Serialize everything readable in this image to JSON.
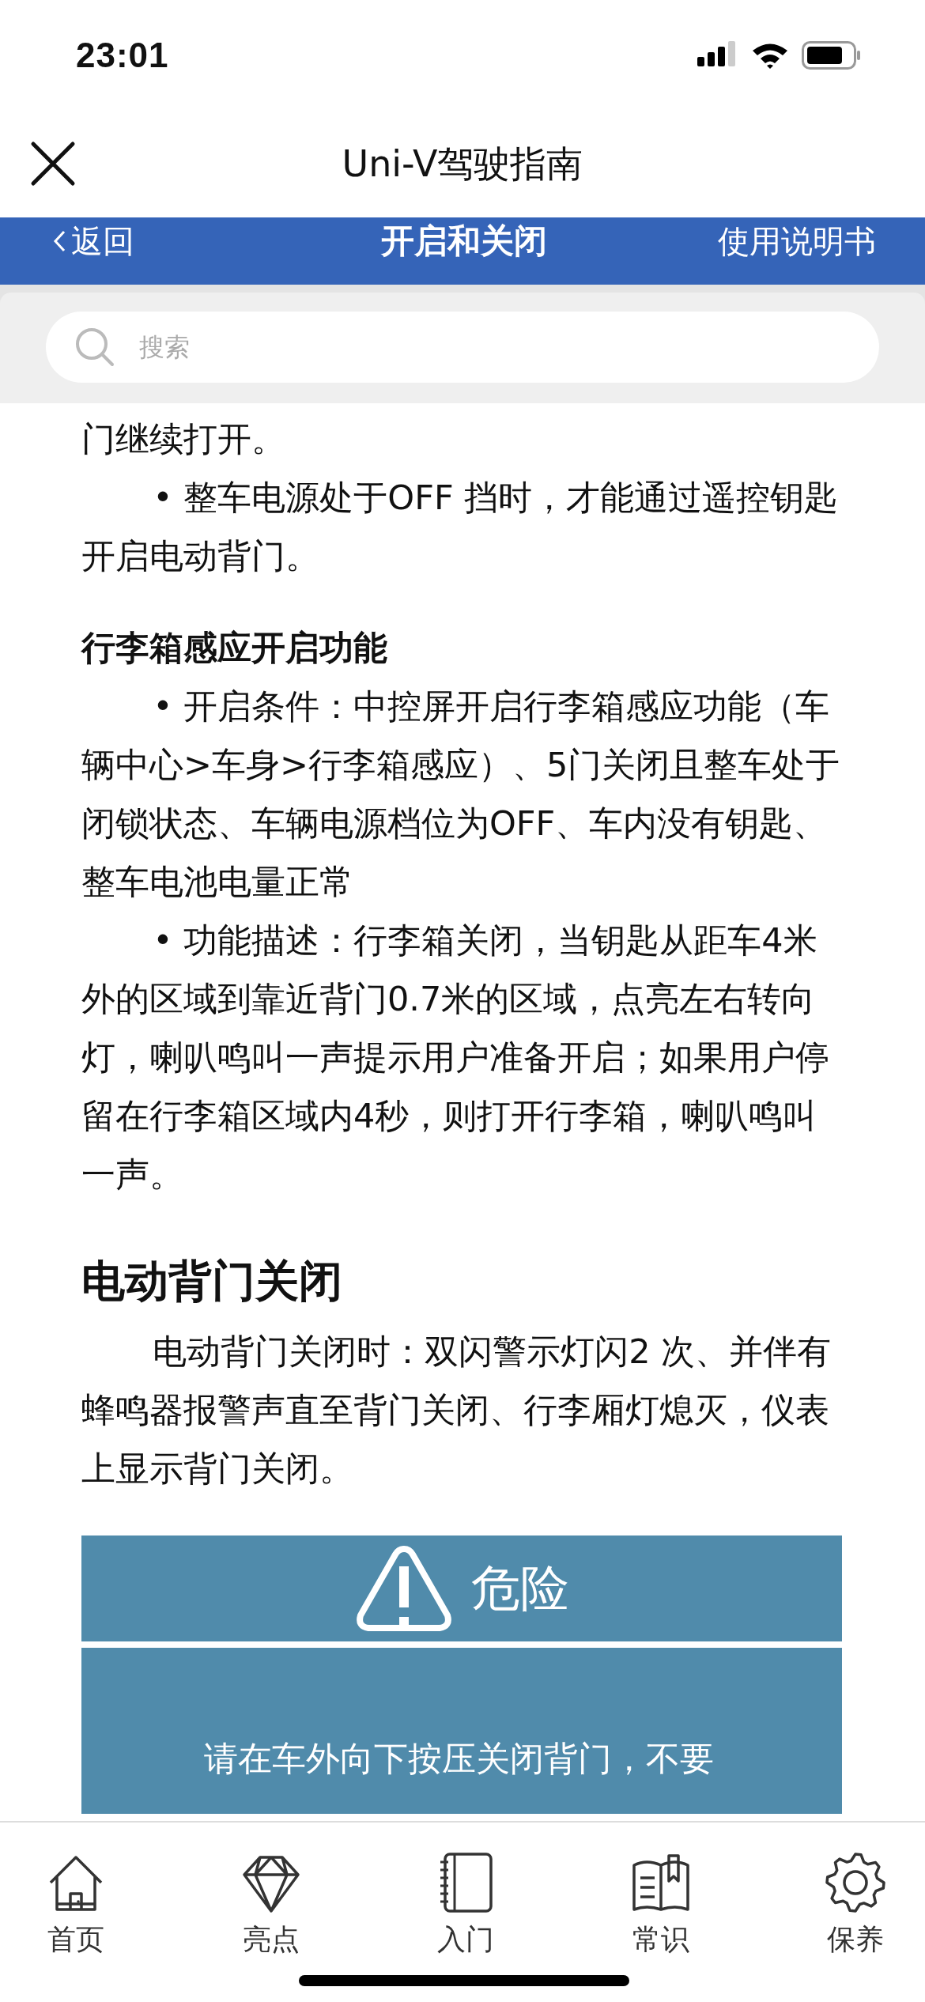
{
  "status_bar": {
    "time": "23:01"
  },
  "title_bar": {
    "title": "Uni-V驾驶指南"
  },
  "nav_bar": {
    "back": "返回",
    "title": "开启和关闭",
    "action": "使用说明书"
  },
  "search": {
    "placeholder": "搜索"
  },
  "content": [
    {
      "kind": "paragraph",
      "text": "门继续打开。"
    },
    {
      "kind": "bullet",
      "text": "• 整车电源处于OFF 挡时，才能通过遥控钥匙开启电动背门。"
    },
    {
      "kind": "subheading",
      "text": "行李箱感应开启功能"
    },
    {
      "kind": "bullet",
      "text": "• 开启条件：中控屏开启行李箱感应功能（车辆中心>车身>行李箱感应）、5门关闭且整车处于闭锁状态、车辆电源档位为OFF、车内没有钥匙、整车电池电量正常"
    },
    {
      "kind": "bullet",
      "text": "• 功能描述：行李箱关闭，当钥匙从距车4米外的区域到靠近背门0.7米的区域，点亮左右转向灯，喇叭鸣叫一声提示用户准备开启；如果用户停留在行李箱区域内4秒，则打开行李箱，喇叭鸣叫一声。"
    },
    {
      "kind": "heading",
      "text": "电动背门关闭"
    },
    {
      "kind": "bullet",
      "text": "电动背门关闭时：双闪警示灯闪2 次、并伴有蜂鸣器报警声直至背门关闭、行李厢灯熄灭，仪表上显示背门关闭。"
    },
    {
      "kind": "danger",
      "title": "危险",
      "text": "请在车外向下按压关闭背门，不要"
    }
  ],
  "tab_bar": [
    {
      "label": "首页"
    },
    {
      "label": "亮点"
    },
    {
      "label": "入门"
    },
    {
      "label": "常识"
    },
    {
      "label": "保养"
    }
  ]
}
